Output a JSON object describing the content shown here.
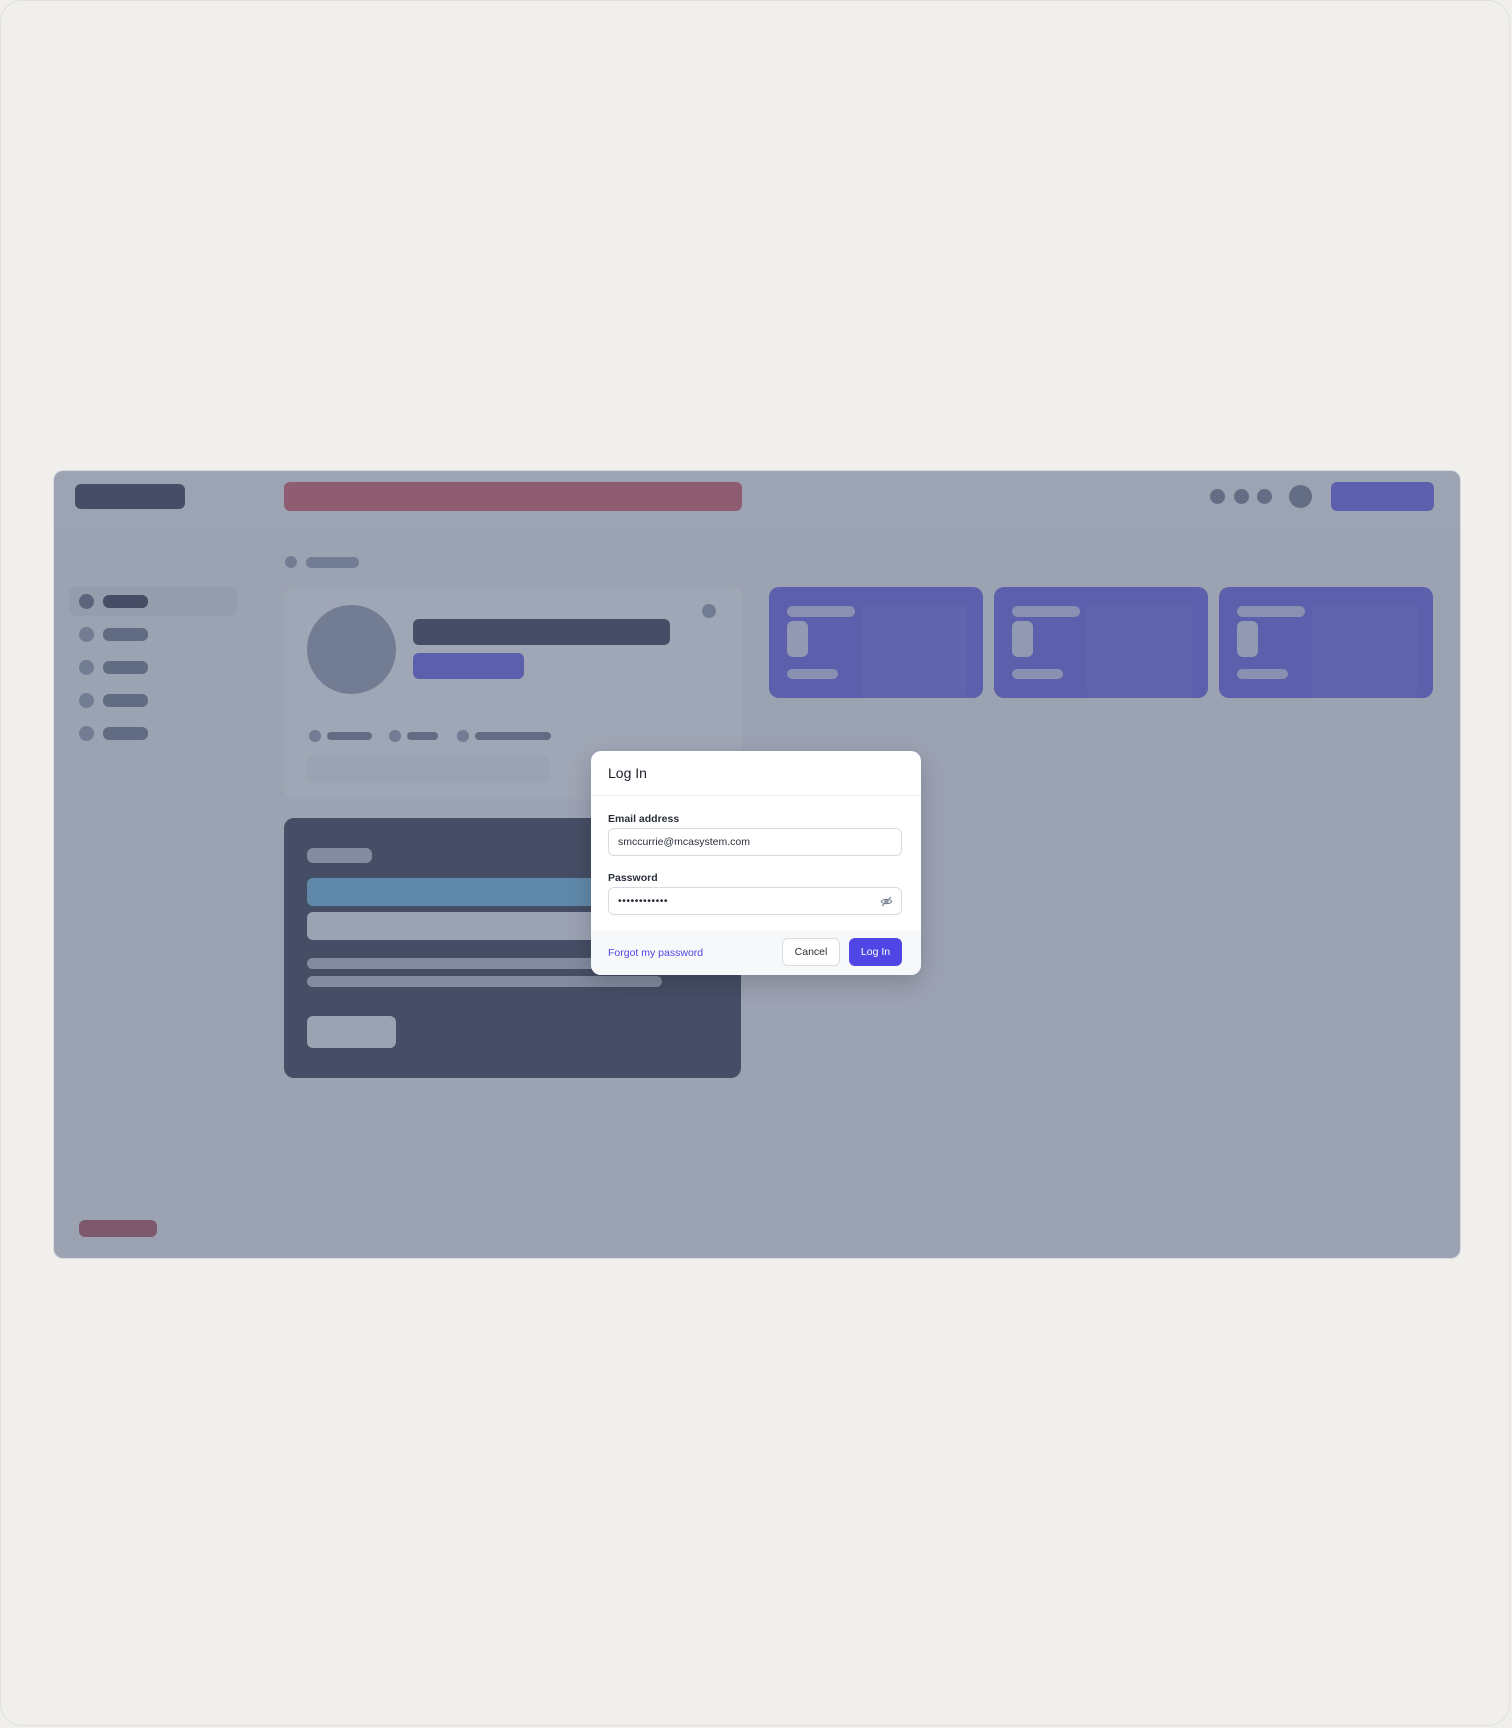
{
  "colors": {
    "background": "#f0efec",
    "scrim": "#647087",
    "accent": "#4f46e5",
    "link": "#4f46e5"
  },
  "login_modal": {
    "title": "Log In",
    "email_label": "Email address",
    "email_value": "smccurrie@mcasystem.com",
    "password_label": "Password",
    "password_value": "••••••••••••",
    "password_visibility_icon": "eye-off-icon",
    "forgot_link": "Forgot my password",
    "cancel_label": "Cancel",
    "submit_label": "Log In"
  }
}
